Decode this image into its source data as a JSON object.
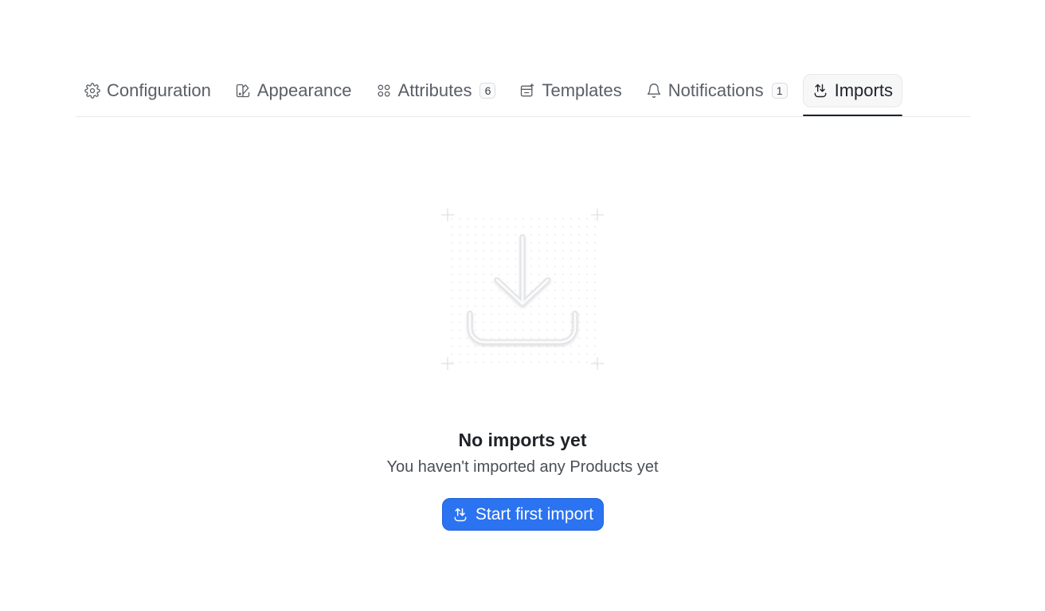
{
  "tabs": [
    {
      "label": "Configuration",
      "icon": "gear-icon",
      "badge": null,
      "active": false
    },
    {
      "label": "Appearance",
      "icon": "palette-icon",
      "badge": null,
      "active": false
    },
    {
      "label": "Attributes",
      "icon": "grid-circles-icon",
      "badge": "6",
      "active": false
    },
    {
      "label": "Templates",
      "icon": "template-icon",
      "badge": null,
      "active": false
    },
    {
      "label": "Notifications",
      "icon": "bell-icon",
      "badge": "1",
      "active": false
    },
    {
      "label": "Imports",
      "icon": "import-arrows-icon",
      "badge": null,
      "active": true
    }
  ],
  "empty_state": {
    "illustration": "download-tray-icon",
    "title": "No imports yet",
    "subtitle": "You haven't imported any Products yet",
    "cta_label": "Start first import",
    "cta_icon": "import-arrows-icon"
  },
  "colors": {
    "accent": "#2b73f0",
    "text": "#1f2328",
    "muted": "#5a5f66",
    "border": "#e6e8eb"
  }
}
